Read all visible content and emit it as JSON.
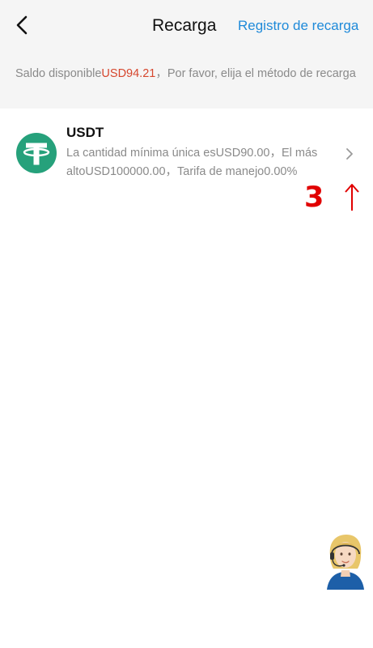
{
  "header": {
    "title": "Recarga",
    "records_link": "Registro de recarga",
    "link_color": "#1f8ad9"
  },
  "info": {
    "prefix": "Saldo disponible",
    "balance": "USD94.21",
    "suffix": "，Por favor, elija el método de recarga"
  },
  "methods": [
    {
      "name": "USDT",
      "icon": "tether-icon",
      "description": " La cantidad mínima única esUSD90.00，El más altoUSD100000.00，Tarifa de manejo0.00%"
    }
  ],
  "annotation": {
    "step": "3"
  },
  "icons": {
    "back": "chevron-left-icon",
    "row_arrow": "chevron-right-icon",
    "support": "customer-service-avatar"
  },
  "colors": {
    "balance": "#d6472e",
    "tether_green": "#26a17b",
    "annotation_red": "#e10000"
  }
}
